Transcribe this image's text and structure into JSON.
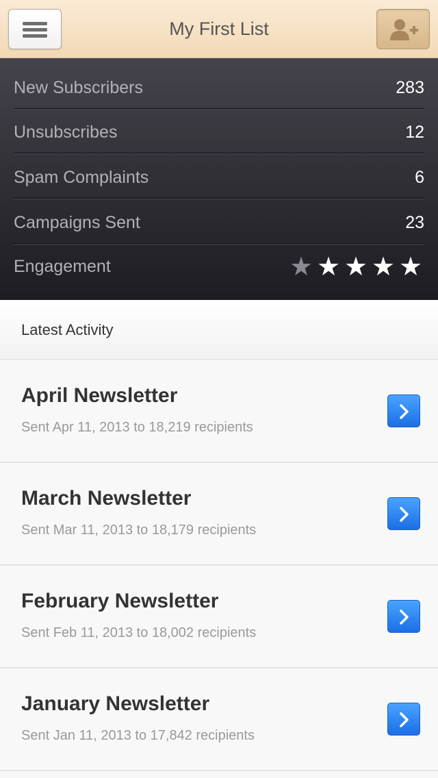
{
  "header": {
    "title": "My First List",
    "menu_icon": "hamburger-menu-icon",
    "add_icon": "add-user-icon"
  },
  "stats": [
    {
      "label": "New Subscribers",
      "value": "283"
    },
    {
      "label": "Unsubscribes",
      "value": "12"
    },
    {
      "label": "Spam Complaints",
      "value": "6"
    },
    {
      "label": "Campaigns Sent",
      "value": "23"
    }
  ],
  "engagement": {
    "label": "Engagement",
    "rating": 4,
    "max": 5
  },
  "activity": {
    "heading": "Latest Activity",
    "items": [
      {
        "title": "April Newsletter",
        "subtitle": "Sent Apr 11, 2013 to 18,219 recipients"
      },
      {
        "title": "March Newsletter",
        "subtitle": "Sent Mar 11, 2013 to 18,179 recipients"
      },
      {
        "title": "February Newsletter",
        "subtitle": "Sent Feb 11, 2013 to 18,002 recipients"
      },
      {
        "title": "January Newsletter",
        "subtitle": "Sent Jan 11, 2013 to 17,842 recipients"
      }
    ]
  },
  "colors": {
    "accent_blue": "#2a82f0",
    "header_bg": "#f4dfc0",
    "stats_bg": "#2e2d33"
  }
}
